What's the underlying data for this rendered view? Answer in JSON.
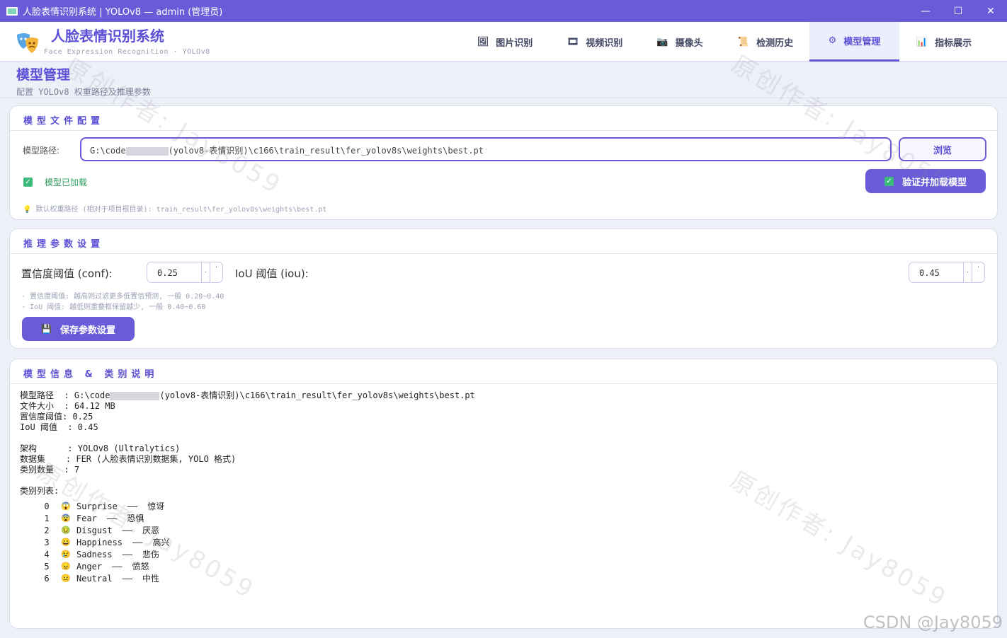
{
  "window": {
    "title": "人脸表情识别系统 | YOLOv8 — admin (管理员)",
    "minimize": "—",
    "maximize": "☐",
    "close": "✕"
  },
  "header": {
    "brand_title": "人脸表情识别系统",
    "brand_subtitle": "Face Expression Recognition  ·  YOLOv8",
    "tabs": [
      {
        "label": "图片识别",
        "icon": "image-icon"
      },
      {
        "label": "视频识别",
        "icon": "film-icon"
      },
      {
        "label": "摄像头",
        "icon": "camera-icon"
      },
      {
        "label": "检测历史",
        "icon": "history-icon"
      },
      {
        "label": "模型管理",
        "icon": "gear-icon",
        "active": true
      },
      {
        "label": "指标展示",
        "icon": "chart-icon"
      }
    ]
  },
  "page": {
    "title": "模型管理",
    "subtitle": "配置 YOLOv8 权重路径及推理参数"
  },
  "model_file": {
    "section_title": "模型文件配置",
    "path_label": "模型路径:",
    "path_prefix": "G:\\code",
    "path_suffix": "(yolov8-表情识别)\\c166\\train_result\\fer_yolov8s\\weights\\best.pt",
    "browse_label": "浏览",
    "status_text": "模型已加载",
    "load_button": "验证并加载模型",
    "hint": "默认权重路径 (相对于项目根目录): train_result\\fer_yolov8s\\weights\\best.pt"
  },
  "inference": {
    "section_title": "推理参数设置",
    "conf_label": "置信度阈值 (conf):",
    "conf_value": "0.25",
    "iou_label": "IoU 阈值 (iou):",
    "iou_value": "0.45",
    "hint1": "· 置信度阈值: 越高则过滤更多低置信预测, 一般 0.20~0.40",
    "hint2": "· IoU 阈值: 越低则重叠框保留越少, 一般 0.40~0.60",
    "save_button": "保存参数设置"
  },
  "model_info": {
    "section_title": "模型信息 & 类别说明",
    "path_line_prefix": "模型路径  : G:\\code",
    "path_line_suffix": "(yolov8-表情识别)\\c166\\train_result\\fer_yolov8s\\weights\\best.pt",
    "lines1": "文件大小  : 64.12 MB\n置信度阈值: 0.25\nIoU 阈值  : 0.45\n\n架构      : YOLOv8 (Ultralytics)\n数据集    : FER (人脸表情识别数据集, YOLO 格式)\n类别数量  : 7\n\n类别列表:",
    "classes": [
      {
        "idx": "0",
        "emoji": "😱",
        "en": "Surprise",
        "zh": "惊讶"
      },
      {
        "idx": "1",
        "emoji": "😨",
        "en": "Fear",
        "zh": "恐惧"
      },
      {
        "idx": "2",
        "emoji": "🤢",
        "en": "Disgust",
        "zh": "厌恶"
      },
      {
        "idx": "3",
        "emoji": "😄",
        "en": "Happiness",
        "zh": "高兴"
      },
      {
        "idx": "4",
        "emoji": "😢",
        "en": "Sadness",
        "zh": "悲伤"
      },
      {
        "idx": "5",
        "emoji": "😠",
        "en": "Anger",
        "zh": "愤怒"
      },
      {
        "idx": "6",
        "emoji": "😐",
        "en": "Neutral",
        "zh": "中性"
      }
    ],
    "separator": "——"
  },
  "watermark": "原创作者: Jay8059",
  "csdn_mark": "CSDN @Jay8059",
  "colors": {
    "accent": "#6a5bd8",
    "status_green": "#3dbb7a"
  }
}
